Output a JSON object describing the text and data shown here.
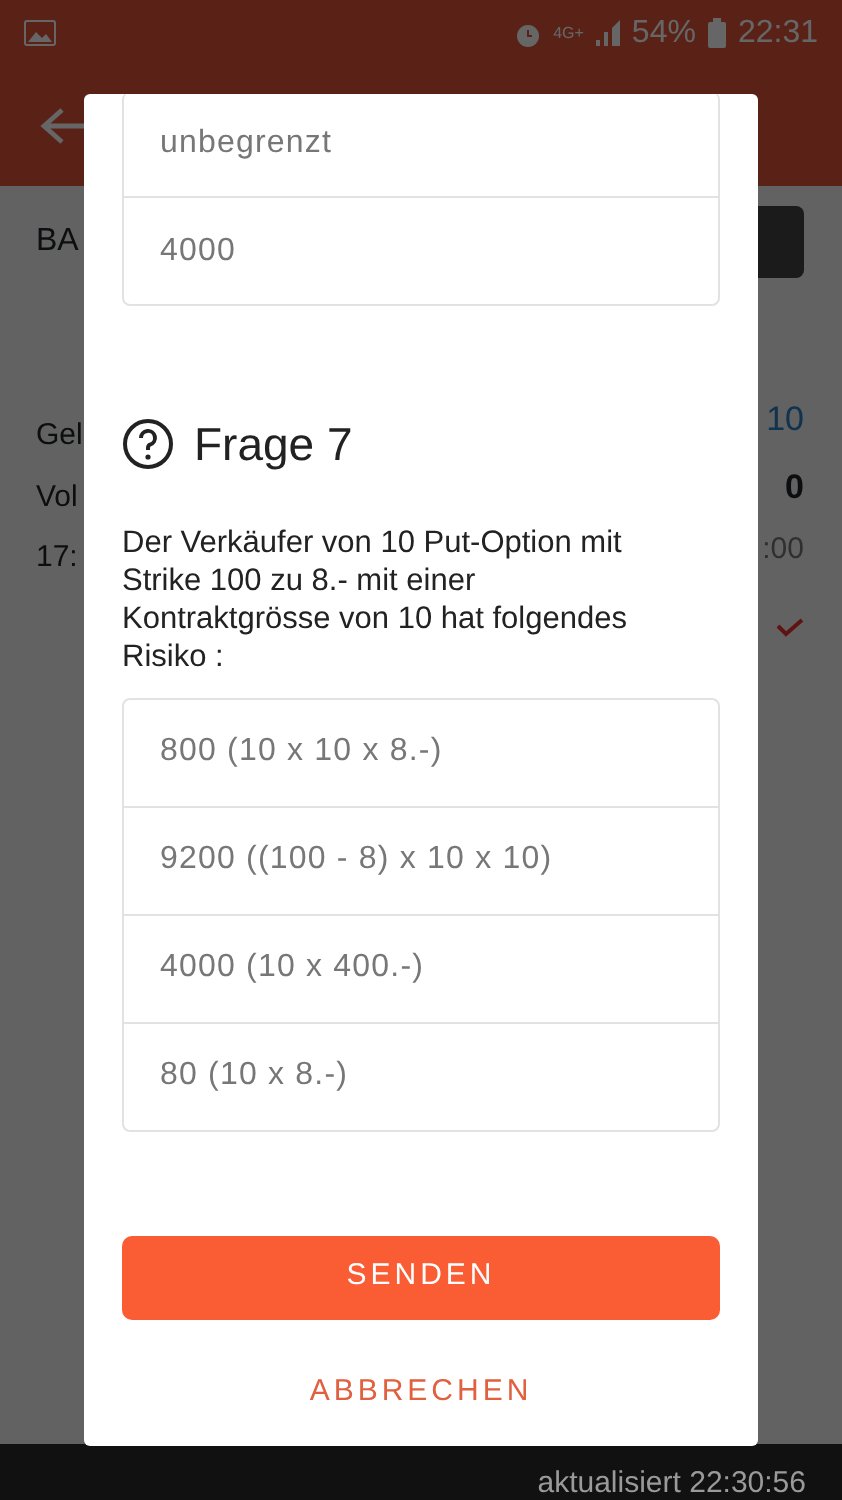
{
  "status_bar": {
    "battery": "54%",
    "time": "22:31",
    "network": "4G+"
  },
  "background": {
    "header_left": "BA",
    "rows": [
      {
        "label": "Gel",
        "value": "10",
        "kind": "link"
      },
      {
        "label": "Vol",
        "value": "0",
        "kind": "bold"
      },
      {
        "label": "17:",
        "value": ":00",
        "kind": "muted"
      }
    ],
    "footer": "aktualisiert 22:30:56"
  },
  "dialog": {
    "previous_answers": [
      {
        "text": "unbegrenzt",
        "selected": false
      },
      {
        "text": "4000",
        "selected": false
      }
    ],
    "title": "Frage 7",
    "question": "Der Verkäufer von 10 Put-Option mit Strike 100 zu 8.- mit einer Kontraktgrösse von 10 hat folgendes Risiko :",
    "answers": [
      {
        "text": "800 (10 x 10 x 8.-)",
        "selected": false
      },
      {
        "text": "9200 ((100 - 8) x 10 x 10)",
        "selected": false
      },
      {
        "text": "4000 (10 x 400.-)",
        "selected": false
      },
      {
        "text": "80 (10 x 8.-)",
        "selected": false
      }
    ],
    "submit": "SENDEN",
    "cancel": "ABBRECHEN"
  }
}
